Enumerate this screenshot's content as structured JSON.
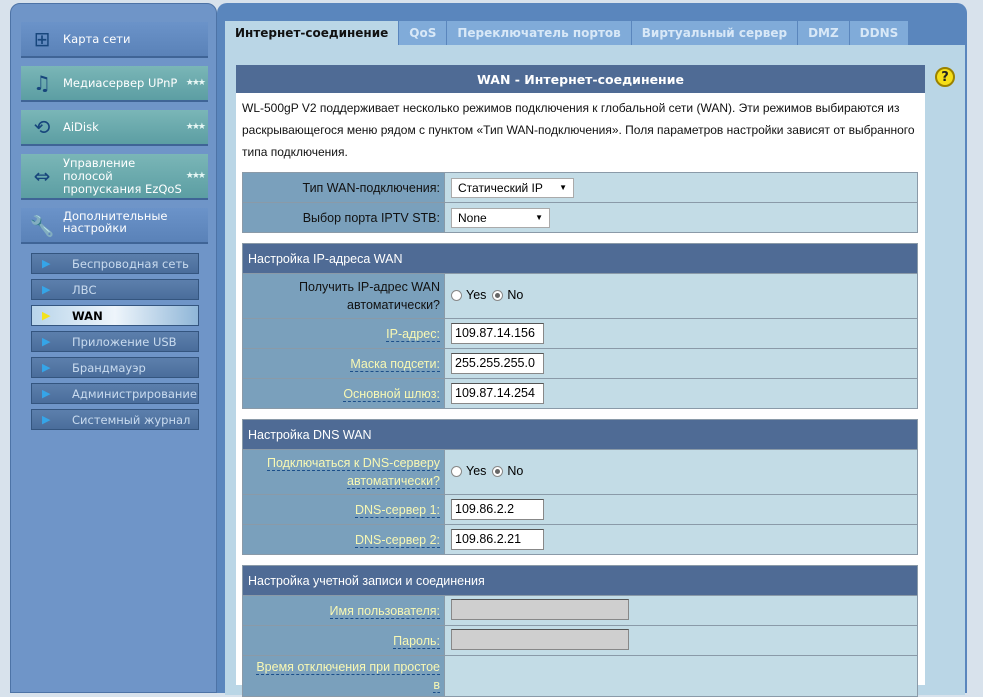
{
  "sidebar": {
    "main_items": [
      {
        "label": "Карта сети",
        "icon": "network-map-icon"
      },
      {
        "label": "Медиасервер UPnP",
        "icon": "media-server-icon"
      },
      {
        "label": "AiDisk",
        "icon": "aidisk-icon"
      },
      {
        "label": "Управление полосой пропускания EzQoS",
        "icon": "ezqos-icon"
      },
      {
        "label": "Дополнительные настройки",
        "icon": "tools-icon"
      }
    ],
    "sub_items": [
      "Беспроводная сеть",
      "ЛВС",
      "WAN",
      "Приложение USB",
      "Брандмауэр",
      "Администрирование",
      "Системный журнал"
    ]
  },
  "tabs": [
    "Интернет-соединение",
    "QoS",
    "Переключатель портов",
    "Виртуальный сервер",
    "DMZ",
    "DDNS"
  ],
  "panel": {
    "title": "WAN - Интернет-соединение",
    "description": "WL-500gP V2 поддерживает несколько режимов подключения к глобальной сети (WAN). Эти режимов выбираются из раскрывающегося меню рядом с пунктом «Тип WAN-подключения». Поля параметров настройки зависят от выбранного типа подключения.",
    "help": "?"
  },
  "general": {
    "wan_type_label": "Тип WAN-подключения:",
    "wan_type_value": "Статический IP",
    "iptv_label": "Выбор порта IPTV STB:",
    "iptv_value": "None"
  },
  "ip_section": {
    "title": "Настройка IP-адреса WAN",
    "auto_label": "Получить IP-адрес WAN автоматически?",
    "yes": "Yes",
    "no": "No",
    "auto_value": "No",
    "ip_label": "IP-адрес:",
    "ip_value": "109.87.14.156",
    "mask_label": "Маска подсети:",
    "mask_value": "255.255.255.0",
    "gw_label": "Основной шлюз:",
    "gw_value": "109.87.14.254"
  },
  "dns_section": {
    "title": "Настройка DNS WAN",
    "auto_label": "Подключаться к DNS-серверу автоматически?",
    "yes": "Yes",
    "no": "No",
    "auto_value": "No",
    "dns1_label": "DNS-сервер 1:",
    "dns1_value": "109.86.2.2",
    "dns2_label": "DNS-сервер 2:",
    "dns2_value": "109.86.2.21"
  },
  "account_section": {
    "title": "Настройка учетной записи и соединения",
    "user_label": "Имя пользователя:",
    "user_value": "",
    "pass_label": "Пароль:",
    "pass_value": "",
    "idle_label": "Время отключения при простое в"
  }
}
